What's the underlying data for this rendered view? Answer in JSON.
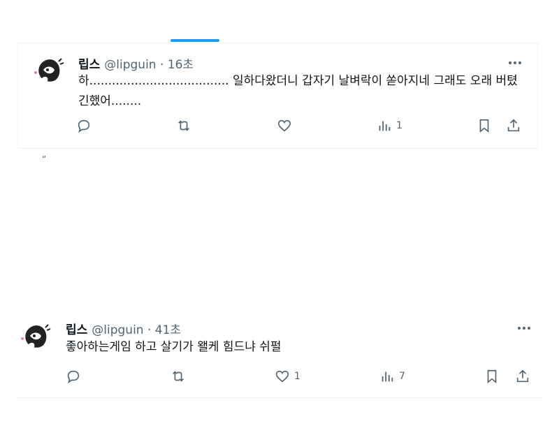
{
  "tweets": [
    {
      "name": "립스",
      "handle": "@lipguin · 16초",
      "text": "하..................................... 일하다왔더니 갑자기 날벼락이 쏟아지네 그래도 오래 버텼긴했어........",
      "views": "1"
    },
    {
      "name": "립스",
      "handle": "@lipguin · 41초",
      "text": "좋아하는게임 하고 살기가 왤케 힘드냐 쉬펄",
      "likes": "1",
      "views": "7"
    }
  ],
  "fragment": "“",
  "colors": {
    "accent": "#1d9bf0",
    "text": "#0f1419",
    "secondary": "#536471",
    "border": "#eff3f4"
  },
  "icons": [
    "reply-icon",
    "retweet-icon",
    "heart-icon",
    "views-icon",
    "bookmark-icon",
    "share-icon",
    "more-icon"
  ]
}
